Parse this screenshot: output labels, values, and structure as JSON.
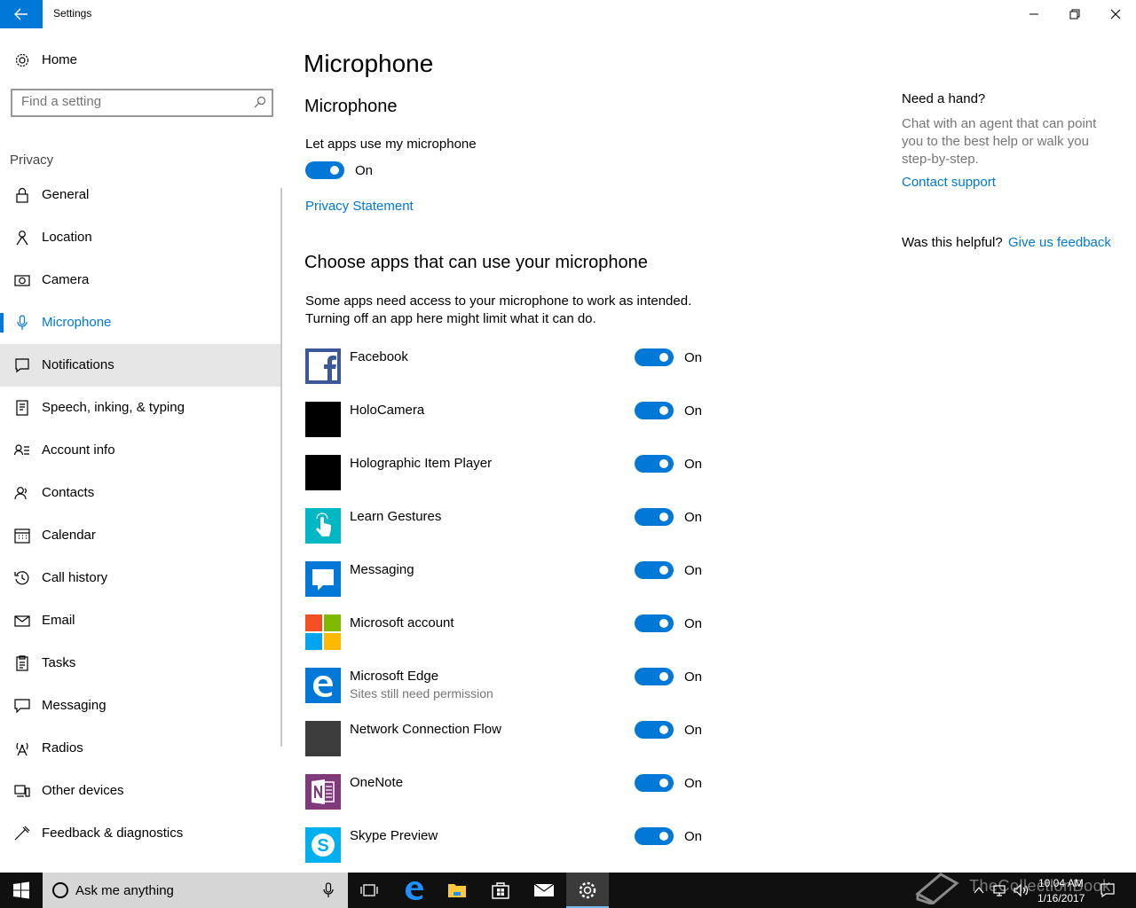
{
  "window": {
    "title": "Settings"
  },
  "sidebar": {
    "home_label": "Home",
    "search_placeholder": "Find a setting",
    "section_label": "Privacy",
    "items": [
      {
        "label": "General"
      },
      {
        "label": "Location"
      },
      {
        "label": "Camera"
      },
      {
        "label": "Microphone"
      },
      {
        "label": "Notifications"
      },
      {
        "label": "Speech, inking, & typing"
      },
      {
        "label": "Account info"
      },
      {
        "label": "Contacts"
      },
      {
        "label": "Calendar"
      },
      {
        "label": "Call history"
      },
      {
        "label": "Email"
      },
      {
        "label": "Tasks"
      },
      {
        "label": "Messaging"
      },
      {
        "label": "Radios"
      },
      {
        "label": "Other devices"
      },
      {
        "label": "Feedback & diagnostics"
      }
    ]
  },
  "main": {
    "page_title": "Microphone",
    "section_title": "Microphone",
    "let_apps_label": "Let apps use my microphone",
    "let_apps_state": "On",
    "privacy_link": "Privacy Statement",
    "choose_title": "Choose apps that can use your microphone",
    "description_line1": "Some apps need access to your microphone to work as intended.",
    "description_line2": "Turning off an app here might limit what it can do.",
    "apps": [
      {
        "name": "Facebook",
        "state": "On",
        "sub": ""
      },
      {
        "name": "HoloCamera",
        "state": "On",
        "sub": ""
      },
      {
        "name": "Holographic Item Player",
        "state": "On",
        "sub": ""
      },
      {
        "name": "Learn Gestures",
        "state": "On",
        "sub": ""
      },
      {
        "name": "Messaging",
        "state": "On",
        "sub": ""
      },
      {
        "name": "Microsoft account",
        "state": "On",
        "sub": ""
      },
      {
        "name": "Microsoft Edge",
        "state": "On",
        "sub": "Sites still need permission"
      },
      {
        "name": "Network Connection Flow",
        "state": "On",
        "sub": ""
      },
      {
        "name": "OneNote",
        "state": "On",
        "sub": ""
      },
      {
        "name": "Skype Preview",
        "state": "On",
        "sub": ""
      }
    ]
  },
  "help": {
    "title": "Need a hand?",
    "line1": "Chat with an agent that can point",
    "line2": "you to the best help or walk you",
    "line3": "step-by-step.",
    "contact_link": "Contact support",
    "helpful_label": "Was this helpful?",
    "feedback_link": "Give us feedback"
  },
  "taskbar": {
    "search_placeholder": "Ask me anything",
    "time": "10:04 AM",
    "date": "1/16/2017"
  },
  "watermark": "TheCollectionBook",
  "colors": {
    "accent": "#0078d7",
    "taskbar": "#101010",
    "hover": "#e6e6e6"
  }
}
